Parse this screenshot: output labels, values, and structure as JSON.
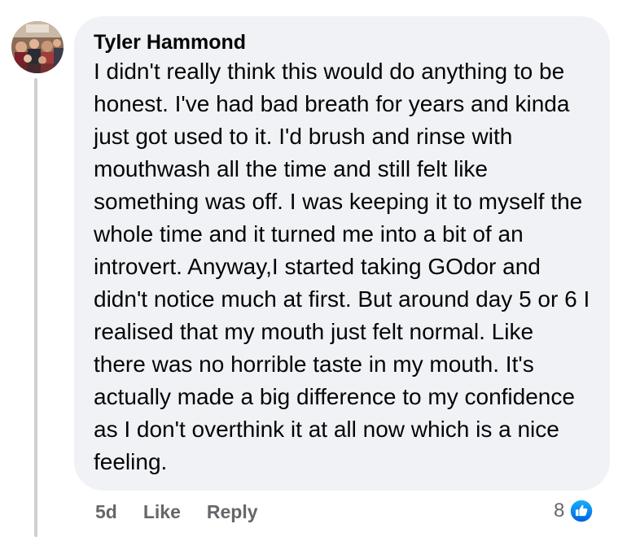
{
  "comment": {
    "author": "Tyler Hammond",
    "text": "I didn't really think this would do anything to be honest. I've had bad breath for years and kinda just got used to it. I'd brush and rinse with mouthwash all the time and still felt like something was off. I was keeping it to myself the whole time and it turned me into a bit of an introvert. Anyway,I started taking GOdor and didn't notice much at first. But around day 5 or 6 I realised that my mouth just felt normal. Like there was no horrible taste in my mouth. It's actually made a big difference to my confidence as I don't overthink it at all now which is a nice feeling.",
    "avatar_icon": "profile-photo-group",
    "timestamp": "5d",
    "like_label": "Like",
    "reply_label": "Reply",
    "reaction_count": "8",
    "reaction_icon": "thumbs-up-icon"
  },
  "colors": {
    "bubble_background": "#f0f2f5",
    "secondary_text": "#65676b",
    "like_blue": "#1877f2",
    "thread_line": "#ced0d4"
  }
}
